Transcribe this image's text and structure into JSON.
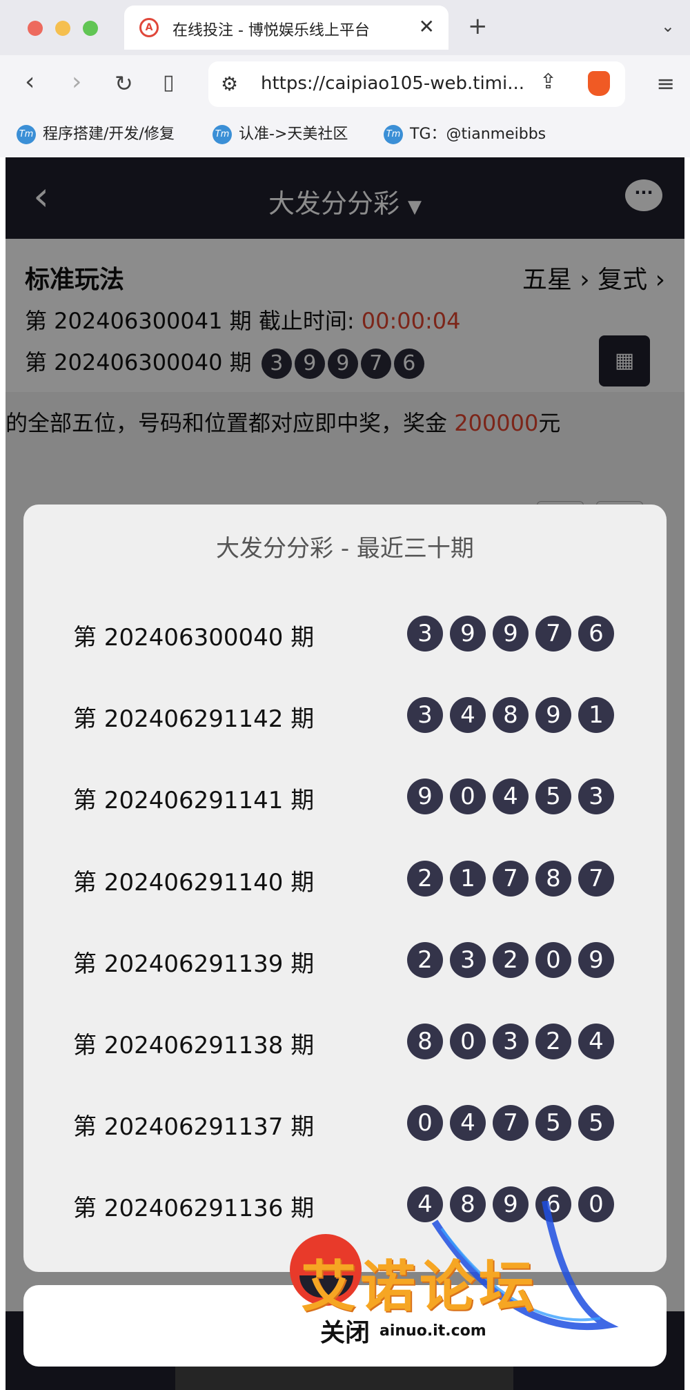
{
  "browser": {
    "tab_title": "在线投注 - 博悦娱乐线上平台",
    "url": "https://caipiao105-web.timi...",
    "bookmarks": [
      "程序搭建/开发/修复",
      "认准->天美社区",
      "TG：@tianmeibbs"
    ]
  },
  "app": {
    "title": "大发分分彩",
    "play_label": "标准玩法",
    "mode_a": "五星",
    "mode_b": "复式",
    "current_issue": "第 202406300041 期 截止时间: ",
    "deadline": "00:00:04",
    "prev_issue": "第 202406300040 期",
    "prev_balls": [
      "3",
      "9",
      "9",
      "7",
      "6"
    ],
    "desc_text": "的全部五位，号码和位置都对应即中奖，奖金 ",
    "desc_amount": "200000",
    "desc_unit": "元"
  },
  "modal": {
    "title": "大发分分彩 - 最近三十期",
    "close_label": "关闭",
    "rows": [
      {
        "issue": "第 202406300040 期",
        "balls": [
          "3",
          "9",
          "9",
          "7",
          "6"
        ]
      },
      {
        "issue": "第 202406291142 期",
        "balls": [
          "3",
          "4",
          "8",
          "9",
          "1"
        ]
      },
      {
        "issue": "第 202406291141 期",
        "balls": [
          "9",
          "0",
          "4",
          "5",
          "3"
        ]
      },
      {
        "issue": "第 202406291140 期",
        "balls": [
          "2",
          "1",
          "7",
          "8",
          "7"
        ]
      },
      {
        "issue": "第 202406291139 期",
        "balls": [
          "2",
          "3",
          "2",
          "0",
          "9"
        ]
      },
      {
        "issue": "第 202406291138 期",
        "balls": [
          "8",
          "0",
          "3",
          "2",
          "4"
        ]
      },
      {
        "issue": "第 202406291137 期",
        "balls": [
          "0",
          "4",
          "7",
          "5",
          "5"
        ]
      },
      {
        "issue": "第 202406291136 期",
        "balls": [
          "4",
          "8",
          "9",
          "6",
          "0"
        ]
      }
    ]
  },
  "watermark": {
    "text": "艾诺论坛",
    "url": "ainuo.it.com"
  },
  "colors": {
    "header_dark": "#1f1f2c",
    "ball": "#34344a",
    "accent_red": "#e2442f",
    "watermark_orange": "#f6a623"
  }
}
